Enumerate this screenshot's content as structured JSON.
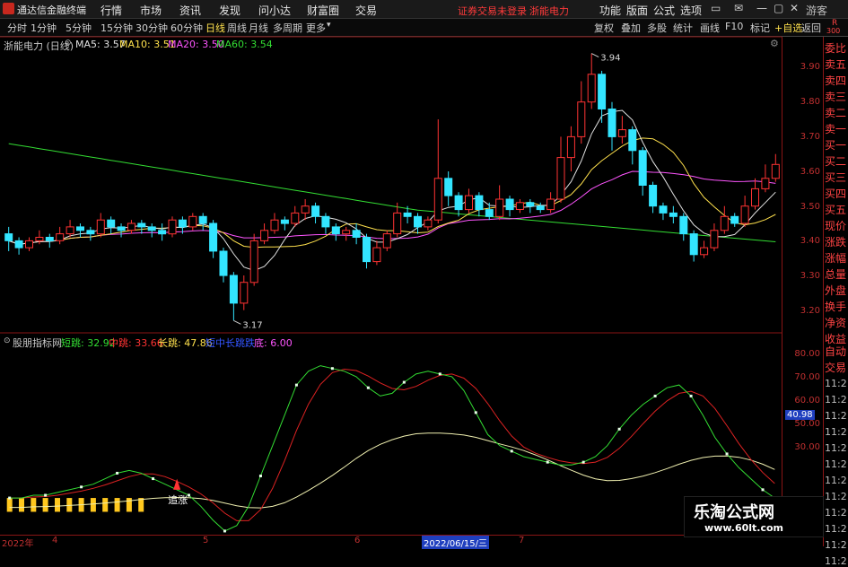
{
  "titlebar": {
    "app_name": "通达信金融终端",
    "menus": [
      "行情",
      "市场",
      "资讯",
      "发现",
      "问小达",
      "财富圈",
      "交易"
    ],
    "warning": "证券交易未登录",
    "stock_name": "浙能电力",
    "right_menus": [
      "功能",
      "版面",
      "公式",
      "选项"
    ],
    "guest": "游客"
  },
  "toolbar": {
    "periods": [
      "分时",
      "1分钟",
      "5分钟",
      "15分钟",
      "30分钟",
      "60分钟",
      "日线",
      "周线",
      "月线",
      "多周期",
      "更多"
    ],
    "active_period": "日线",
    "right_buttons": [
      "复权",
      "叠加",
      "多股",
      "统计",
      "画线",
      "F10",
      "标记",
      "+自选",
      "返回"
    ]
  },
  "main_chart": {
    "title": "浙能电力 (日线)",
    "ma5": "MA5: 3.57",
    "ma10": "MA10: 3.51",
    "ma20": "MA20: 3.50",
    "ma60": "MA60: 3.54",
    "high_label": "3.94",
    "low_label": "3.17",
    "yticks": [
      "3.90",
      "3.80",
      "3.70",
      "3.60",
      "3.50",
      "3.40",
      "3.30",
      "3.20"
    ]
  },
  "indicator": {
    "name": "股朋指标网",
    "short": "短跳: 32.92",
    "mid": "中跳: 33.66",
    "long": "长跳: 47.86",
    "extra": "短中长跳跌",
    "bottom": "底: 6.00",
    "mark_text": "追涨",
    "yticks": [
      "80.00",
      "70.00",
      "60.00",
      "50.00",
      "40.98",
      "30.00"
    ]
  },
  "dates": [
    "2022年",
    "4",
    "5",
    "6",
    "2022/06/15/三",
    "7"
  ],
  "sidebar": [
    "委比",
    "卖五",
    "卖四",
    "卖三",
    "卖二",
    "卖一",
    "买一",
    "买二",
    "买三",
    "买四",
    "买五",
    "现价",
    "涨跌",
    "涨幅",
    "总量",
    "外盘",
    "换手",
    "净资",
    "收益",
    "自动",
    "交易",
    "11:2",
    "11:2",
    "11:2",
    "11:2",
    "11:2",
    "11:2",
    "11:2",
    "11:2",
    "11:2",
    "11:2",
    "11:2",
    "11:2"
  ],
  "corner": {
    "top": "R",
    "bottom": "300"
  },
  "watermark": {
    "name": "乐淘公式网",
    "url": "www.60lt.com"
  },
  "chart_data": {
    "type": "candlestick",
    "ylim": [
      3.15,
      3.97
    ],
    "candles": [
      [
        3.42,
        3.4,
        3.44,
        3.37
      ],
      [
        3.4,
        3.38,
        3.41,
        3.36
      ],
      [
        3.38,
        3.4,
        3.41,
        3.37
      ],
      [
        3.4,
        3.41,
        3.43,
        3.39
      ],
      [
        3.41,
        3.4,
        3.42,
        3.38
      ],
      [
        3.4,
        3.42,
        3.44,
        3.39
      ],
      [
        3.42,
        3.44,
        3.46,
        3.41
      ],
      [
        3.44,
        3.43,
        3.45,
        3.41
      ],
      [
        3.43,
        3.42,
        3.44,
        3.4
      ],
      [
        3.42,
        3.46,
        3.48,
        3.41
      ],
      [
        3.46,
        3.44,
        3.47,
        3.42
      ],
      [
        3.44,
        3.43,
        3.45,
        3.41
      ],
      [
        3.43,
        3.45,
        3.46,
        3.42
      ],
      [
        3.45,
        3.44,
        3.46,
        3.42
      ],
      [
        3.44,
        3.43,
        3.45,
        3.41
      ],
      [
        3.43,
        3.42,
        3.45,
        3.4
      ],
      [
        3.42,
        3.46,
        3.47,
        3.41
      ],
      [
        3.46,
        3.44,
        3.47,
        3.42
      ],
      [
        3.44,
        3.47,
        3.48,
        3.43
      ],
      [
        3.47,
        3.45,
        3.48,
        3.43
      ],
      [
        3.45,
        3.37,
        3.46,
        3.35
      ],
      [
        3.37,
        3.3,
        3.38,
        3.28
      ],
      [
        3.3,
        3.22,
        3.31,
        3.17
      ],
      [
        3.22,
        3.28,
        3.3,
        3.2
      ],
      [
        3.28,
        3.4,
        3.42,
        3.27
      ],
      [
        3.4,
        3.43,
        3.45,
        3.39
      ],
      [
        3.43,
        3.46,
        3.48,
        3.42
      ],
      [
        3.46,
        3.45,
        3.47,
        3.43
      ],
      [
        3.45,
        3.48,
        3.5,
        3.44
      ],
      [
        3.48,
        3.5,
        3.52,
        3.46
      ],
      [
        3.5,
        3.47,
        3.51,
        3.45
      ],
      [
        3.47,
        3.44,
        3.48,
        3.42
      ],
      [
        3.44,
        3.42,
        3.45,
        3.4
      ],
      [
        3.42,
        3.43,
        3.44,
        3.4
      ],
      [
        3.43,
        3.41,
        3.45,
        3.39
      ],
      [
        3.41,
        3.34,
        3.42,
        3.32
      ],
      [
        3.34,
        3.38,
        3.4,
        3.33
      ],
      [
        3.38,
        3.42,
        3.43,
        3.37
      ],
      [
        3.42,
        3.48,
        3.51,
        3.41
      ],
      [
        3.48,
        3.47,
        3.5,
        3.45
      ],
      [
        3.47,
        3.44,
        3.48,
        3.42
      ],
      [
        3.44,
        3.46,
        3.47,
        3.43
      ],
      [
        3.46,
        3.58,
        3.75,
        3.45
      ],
      [
        3.58,
        3.53,
        3.6,
        3.5
      ],
      [
        3.53,
        3.49,
        3.54,
        3.47
      ],
      [
        3.49,
        3.53,
        3.55,
        3.48
      ],
      [
        3.53,
        3.49,
        3.54,
        3.47
      ],
      [
        3.49,
        3.47,
        3.51,
        3.46
      ],
      [
        3.47,
        3.52,
        3.56,
        3.46
      ],
      [
        3.52,
        3.49,
        3.53,
        3.47
      ],
      [
        3.49,
        3.51,
        3.52,
        3.48
      ],
      [
        3.51,
        3.5,
        3.52,
        3.48
      ],
      [
        3.5,
        3.49,
        3.51,
        3.48
      ],
      [
        3.49,
        3.52,
        3.54,
        3.48
      ],
      [
        3.52,
        3.64,
        3.7,
        3.51
      ],
      [
        3.64,
        3.7,
        3.73,
        3.6
      ],
      [
        3.7,
        3.8,
        3.86,
        3.68
      ],
      [
        3.8,
        3.88,
        3.94,
        3.78
      ],
      [
        3.88,
        3.78,
        3.89,
        3.74
      ],
      [
        3.78,
        3.7,
        3.8,
        3.66
      ],
      [
        3.7,
        3.72,
        3.76,
        3.68
      ],
      [
        3.72,
        3.66,
        3.73,
        3.62
      ],
      [
        3.66,
        3.56,
        3.67,
        3.53
      ],
      [
        3.56,
        3.5,
        3.57,
        3.48
      ],
      [
        3.5,
        3.48,
        3.51,
        3.46
      ],
      [
        3.48,
        3.47,
        3.5,
        3.45
      ],
      [
        3.47,
        3.42,
        3.48,
        3.4
      ],
      [
        3.42,
        3.36,
        3.43,
        3.34
      ],
      [
        3.36,
        3.38,
        3.4,
        3.35
      ],
      [
        3.38,
        3.43,
        3.45,
        3.37
      ],
      [
        3.43,
        3.47,
        3.5,
        3.42
      ],
      [
        3.47,
        3.45,
        3.48,
        3.44
      ],
      [
        3.45,
        3.5,
        3.53,
        3.44
      ],
      [
        3.5,
        3.55,
        3.58,
        3.49
      ],
      [
        3.55,
        3.58,
        3.62,
        3.54
      ],
      [
        3.58,
        3.62,
        3.65,
        3.57
      ]
    ],
    "osc_short": [
      33,
      33,
      34,
      34,
      35,
      36,
      37,
      38,
      40,
      42,
      43,
      42,
      40,
      38,
      36,
      34,
      30,
      25,
      21,
      23,
      30,
      41,
      52,
      63,
      74,
      79,
      81,
      80,
      79,
      77,
      73,
      70,
      71,
      75,
      78,
      79,
      78,
      77,
      72,
      64,
      56,
      52,
      50,
      48,
      47,
      46,
      45,
      45,
      46,
      48,
      52,
      58,
      63,
      67,
      70,
      73,
      74,
      70,
      63,
      55,
      49,
      44,
      40,
      36,
      33
    ]
  }
}
